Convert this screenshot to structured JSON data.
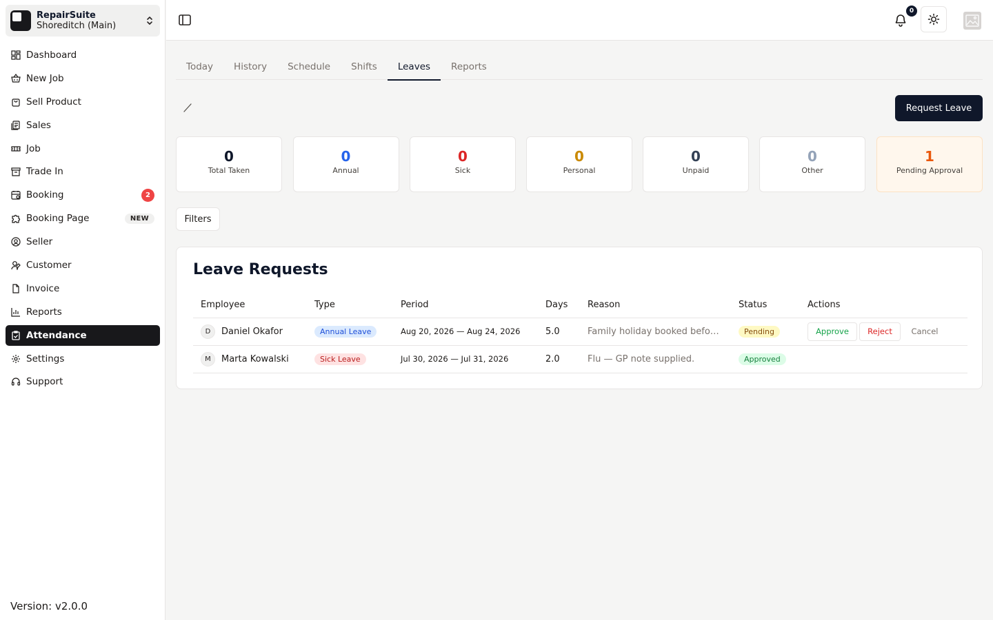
{
  "org": {
    "name": "RepairSuite",
    "branch": "Shoreditch (Main)"
  },
  "nav": [
    {
      "label": "Dashboard",
      "icon": "dashboard-icon"
    },
    {
      "label": "New Job",
      "icon": "basket-icon"
    },
    {
      "label": "Sell Product",
      "icon": "shopping-bag-icon"
    },
    {
      "label": "Sales",
      "icon": "receipt-icon"
    },
    {
      "label": "Job",
      "icon": "ticket-icon"
    },
    {
      "label": "Trade In",
      "icon": "archive-icon"
    },
    {
      "label": "Booking",
      "icon": "calendar-icon",
      "badge": "2"
    },
    {
      "label": "Booking Page",
      "icon": "puzzle-icon",
      "tag": "NEW"
    },
    {
      "label": "Seller",
      "icon": "user-circle-icon"
    },
    {
      "label": "Customer",
      "icon": "user-pen-icon"
    },
    {
      "label": "Invoice",
      "icon": "file-icon"
    },
    {
      "label": "Reports",
      "icon": "chart-icon"
    },
    {
      "label": "Attendance",
      "icon": "clipboard-check-icon"
    },
    {
      "label": "Settings",
      "icon": "gear-icon"
    },
    {
      "label": "Support",
      "icon": "headset-icon"
    }
  ],
  "version": "Version: v2.0.0",
  "header": {
    "notifications": "0"
  },
  "tabs": [
    "Today",
    "History",
    "Schedule",
    "Shifts",
    "Leaves",
    "Reports"
  ],
  "request_leave_label": "Request Leave",
  "stats": [
    {
      "value": "0",
      "label": "Total Taken",
      "color": "#0f172a"
    },
    {
      "value": "0",
      "label": "Annual",
      "color": "#2563eb"
    },
    {
      "value": "0",
      "label": "Sick",
      "color": "#dc2626"
    },
    {
      "value": "0",
      "label": "Personal",
      "color": "#ca8a04"
    },
    {
      "value": "0",
      "label": "Unpaid",
      "color": "#334155"
    },
    {
      "value": "0",
      "label": "Other",
      "color": "#94a3b8"
    },
    {
      "value": "1",
      "label": "Pending Approval",
      "color": "#ea580c"
    }
  ],
  "filters_label": "Filters",
  "leave_requests": {
    "title": "Leave Requests",
    "columns": [
      "Employee",
      "Type",
      "Period",
      "Days",
      "Reason",
      "Status",
      "Actions"
    ],
    "rows": [
      {
        "initial": "D",
        "employee": "Daniel Okafor",
        "type": "Annual Leave",
        "period": "Aug 20, 2026 — Aug 24, 2026",
        "days": "5.0",
        "reason": "Family holiday booked befo…",
        "status": "Pending",
        "actions": {
          "approve": "Approve",
          "reject": "Reject",
          "cancel": "Cancel"
        }
      },
      {
        "initial": "M",
        "employee": "Marta Kowalski",
        "type": "Sick Leave",
        "period": "Jul 30, 2026 — Jul 31, 2026",
        "days": "2.0",
        "reason": "Flu — GP note supplied.",
        "status": "Approved"
      }
    ]
  }
}
